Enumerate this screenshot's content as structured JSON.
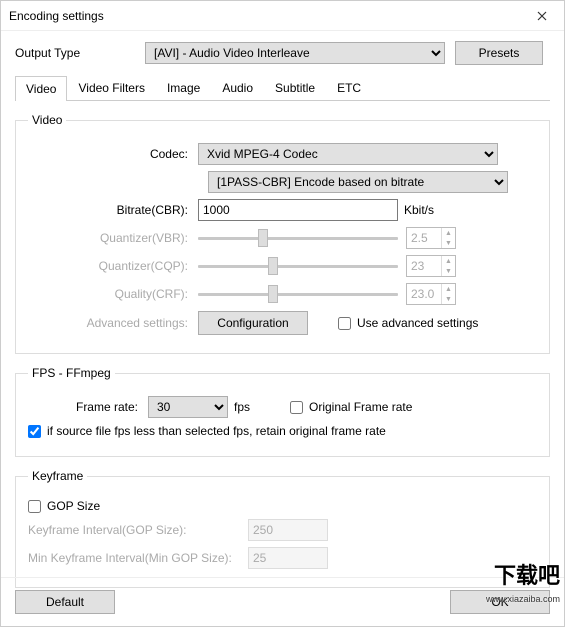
{
  "window": {
    "title": "Encoding settings"
  },
  "output": {
    "label": "Output Type",
    "value": "[AVI] - Audio Video Interleave",
    "presets_label": "Presets"
  },
  "tabs": {
    "items": [
      "Video",
      "Video Filters",
      "Image",
      "Audio",
      "Subtitle",
      "ETC"
    ],
    "active": 0
  },
  "video": {
    "legend": "Video",
    "codec_label": "Codec:",
    "codec_value": "Xvid MPEG-4 Codec",
    "mode_value": "[1PASS-CBR] Encode based on bitrate",
    "bitrate_label": "Bitrate(CBR):",
    "bitrate_value": "1000",
    "bitrate_unit": "Kbit/s",
    "quant_vbr_label": "Quantizer(VBR):",
    "quant_vbr_value": "2.5",
    "quant_cqp_label": "Quantizer(CQP):",
    "quant_cqp_value": "23",
    "quality_crf_label": "Quality(CRF):",
    "quality_crf_value": "23.0",
    "advanced_label": "Advanced settings:",
    "config_label": "Configuration",
    "use_advanced_label": "Use advanced settings",
    "use_advanced_checked": false
  },
  "fps": {
    "legend": "FPS - FFmpeg",
    "framerate_label": "Frame rate:",
    "framerate_value": "30",
    "framerate_unit": "fps",
    "original_label": "Original Frame rate",
    "original_checked": false,
    "retain_label": "if source file fps less than selected fps, retain original frame rate",
    "retain_checked": true
  },
  "keyframe": {
    "legend": "Keyframe",
    "gop_label": "GOP Size",
    "gop_checked": false,
    "interval_label": "Keyframe Interval(GOP Size):",
    "interval_value": "250",
    "min_interval_label": "Min Keyframe Interval(Min GOP Size):",
    "min_interval_value": "25"
  },
  "footer": {
    "default_label": "Default",
    "ok_label": "OK"
  },
  "watermark": {
    "text": "下载吧",
    "url": "www.xiazaiba.com"
  }
}
